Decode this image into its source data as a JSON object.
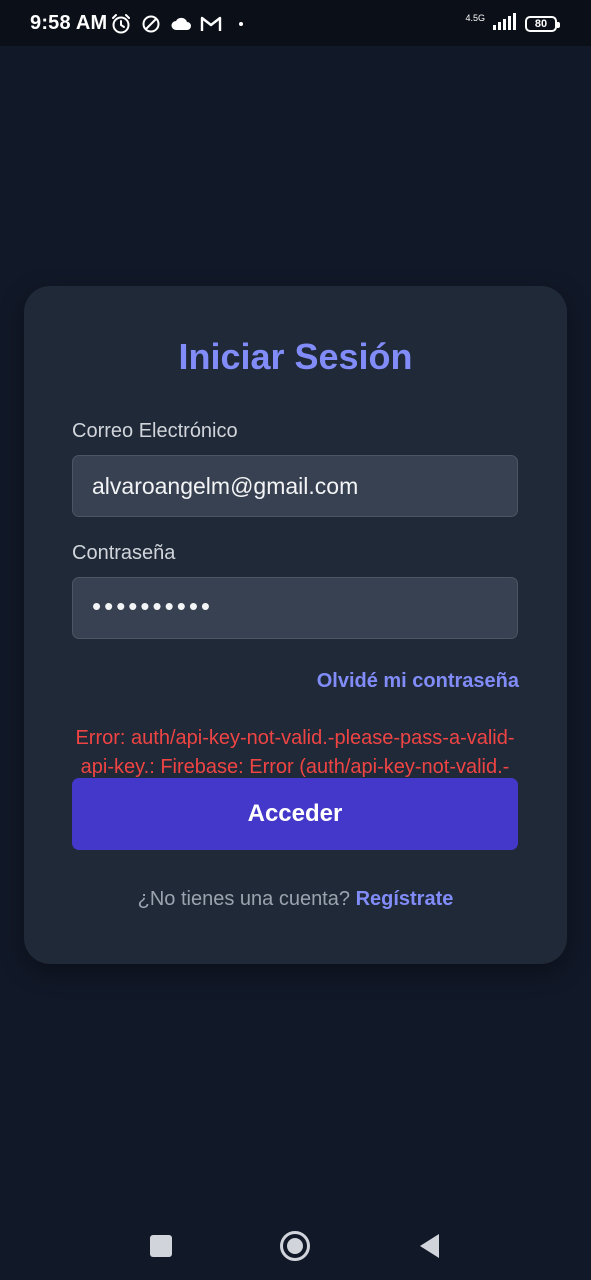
{
  "status_bar": {
    "time": "9:58 AM",
    "network": "4.5G",
    "battery": "80",
    "icons": [
      "alarm-icon",
      "dnd-icon",
      "cloud-icon",
      "gmail-icon",
      "dot-icon",
      "signal-icon",
      "battery-icon"
    ]
  },
  "login": {
    "title": "Iniciar Sesión",
    "email_label": "Correo Electrónico",
    "email_value": "alvaroangelm@gmail.com",
    "password_label": "Contraseña",
    "password_value": "••••••••••",
    "forgot_link": "Olvidé mi contraseña",
    "error_text": "Error: auth/api-key-not-valid.-please-pass-a-valid-api-key.: Firebase: Error (auth/api-key-not-valid.-please-pass-a-valid-api-key.).",
    "submit_label": "Acceder",
    "signup_prompt": "¿No tienes una cuenta?",
    "signup_link": "Regístrate"
  },
  "nav_bar": {
    "icons": [
      "recents-icon",
      "home-icon",
      "back-icon"
    ]
  },
  "colors": {
    "background": "#111827",
    "card": "#1f2937",
    "accent": "#818cf8",
    "button": "#4338ca",
    "error": "#ef4444",
    "input_bg": "#374151"
  }
}
